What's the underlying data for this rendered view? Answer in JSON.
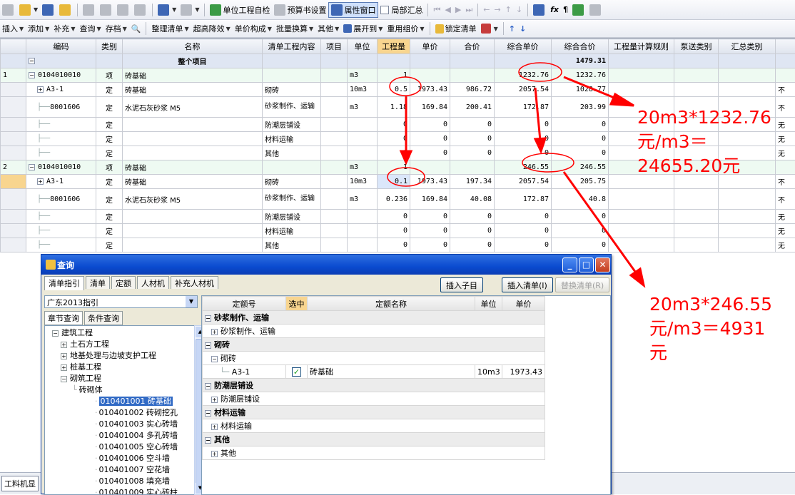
{
  "toolbar1": {
    "self_check": "单位工程自检",
    "budget_settings": "预算书设置",
    "property_window": "属性窗口",
    "partial_summary": "局部汇总"
  },
  "toolbar2": {
    "items": [
      "插入",
      "添加",
      "补充",
      "查询",
      "存档",
      "整理清单",
      "超高降效",
      "单价构成",
      "批量换算",
      "其他",
      "展开到",
      "重用组价",
      "锁定清单"
    ]
  },
  "grid": {
    "headers": [
      "编码",
      "类别",
      "名称",
      "清单工程内容",
      "项目",
      "单位",
      "工程量",
      "单价",
      "合价",
      "综合单价",
      "综合合价",
      "工程量计算规则",
      "泵送类别",
      "汇总类别"
    ],
    "total_row": {
      "name": "整个项目",
      "total": "1479.31"
    },
    "rows": [
      {
        "no": "1",
        "code": "0104010010",
        "cat": "项",
        "name": "砖基础",
        "content": "",
        "unit": "m3",
        "qty": "1",
        "price": "",
        "amount": "",
        "uprice": "1232.76",
        "total": "1232.76",
        "tail": "",
        "kind": "item"
      },
      {
        "no": "",
        "code": "A3-1",
        "cat": "定",
        "name": "砖基础",
        "content": "砌砖",
        "unit": "10m3",
        "qty": "0.5",
        "price": "1973.43",
        "amount": "986.72",
        "uprice": "2057.54",
        "total": "1028.77",
        "tail": "不",
        "kind": "quota"
      },
      {
        "no": "",
        "code": "8001606",
        "cat": "定",
        "name": "水泥石灰砂浆 M5",
        "content": "砂浆制作、运输",
        "unit": "m3",
        "qty": "1.18",
        "price": "169.84",
        "amount": "200.41",
        "uprice": "172.87",
        "total": "203.99",
        "tail": "不",
        "kind": "mat"
      },
      {
        "no": "",
        "code": "",
        "cat": "定",
        "name": "",
        "content": "防潮层铺设",
        "unit": "",
        "qty": "0",
        "price": "0",
        "amount": "0",
        "uprice": "0",
        "total": "0",
        "tail": "无",
        "kind": "empty"
      },
      {
        "no": "",
        "code": "",
        "cat": "定",
        "name": "",
        "content": "材料运输",
        "unit": "",
        "qty": "0",
        "price": "0",
        "amount": "0",
        "uprice": "0",
        "total": "0",
        "tail": "无",
        "kind": "empty"
      },
      {
        "no": "",
        "code": "",
        "cat": "定",
        "name": "",
        "content": "其他",
        "unit": "",
        "qty": "0",
        "price": "0",
        "amount": "0",
        "uprice": "0",
        "total": "0",
        "tail": "无",
        "kind": "empty"
      },
      {
        "no": "2",
        "code": "0104010010",
        "cat": "项",
        "name": "砖基础",
        "content": "",
        "unit": "m3",
        "qty": "1",
        "price": "",
        "amount": "",
        "uprice": "246.55",
        "total": "246.55",
        "tail": "",
        "kind": "item"
      },
      {
        "no": "",
        "code": "A3-1",
        "cat": "定",
        "name": "砖基础",
        "content": "砌砖",
        "unit": "10m3",
        "qty": "0.1",
        "price": "1973.43",
        "amount": "197.34",
        "uprice": "2057.54",
        "total": "205.75",
        "tail": "不",
        "kind": "quota"
      },
      {
        "no": "",
        "code": "8001606",
        "cat": "定",
        "name": "水泥石灰砂浆 M5",
        "content": "砂浆制作、运输",
        "unit": "m3",
        "qty": "0.236",
        "price": "169.84",
        "amount": "40.08",
        "uprice": "172.87",
        "total": "40.8",
        "tail": "不",
        "kind": "mat"
      },
      {
        "no": "",
        "code": "",
        "cat": "定",
        "name": "",
        "content": "防潮层铺设",
        "unit": "",
        "qty": "0",
        "price": "0",
        "amount": "0",
        "uprice": "0",
        "total": "0",
        "tail": "无",
        "kind": "empty"
      },
      {
        "no": "",
        "code": "",
        "cat": "定",
        "name": "",
        "content": "材料运输",
        "unit": "",
        "qty": "0",
        "price": "0",
        "amount": "0",
        "uprice": "0",
        "total": "0",
        "tail": "无",
        "kind": "empty"
      },
      {
        "no": "",
        "code": "",
        "cat": "定",
        "name": "",
        "content": "其他",
        "unit": "",
        "qty": "0",
        "price": "0",
        "amount": "0",
        "uprice": "0",
        "total": "0",
        "tail": "无",
        "kind": "empty"
      }
    ]
  },
  "bottom_tab": "工料机显",
  "dialog": {
    "title": "查询",
    "tabs": [
      "清单指引",
      "清单",
      "定额",
      "人材机",
      "补充人材机"
    ],
    "btn_insert_child": "插入子目",
    "btn_insert_list": "插入清单(I)",
    "btn_replace_list": "替换清单(R)",
    "guide_select": "广东2013指引",
    "left_tabs": [
      "章节查询",
      "条件查询"
    ],
    "tree": [
      {
        "label": "建筑工程",
        "level": 0,
        "pm": "−",
        "sel": false
      },
      {
        "label": "土石方工程",
        "level": 1,
        "pm": "+",
        "sel": false
      },
      {
        "label": "地基处理与边坡支护工程",
        "level": 1,
        "pm": "+",
        "sel": false
      },
      {
        "label": "桩基工程",
        "level": 1,
        "pm": "+",
        "sel": false
      },
      {
        "label": "砌筑工程",
        "level": 1,
        "pm": "−",
        "sel": false
      },
      {
        "label": "砖砌体",
        "level": 2,
        "pm": "",
        "sel": false
      },
      {
        "label": "010401001  砖基础",
        "level": 3,
        "pm": "",
        "sel": true
      },
      {
        "label": "010401002  砖砌挖孔",
        "level": 3,
        "pm": "",
        "sel": false
      },
      {
        "label": "010401003  实心砖墙",
        "level": 3,
        "pm": "",
        "sel": false
      },
      {
        "label": "010401004  多孔砖墙",
        "level": 3,
        "pm": "",
        "sel": false
      },
      {
        "label": "010401005  空心砖墙",
        "level": 3,
        "pm": "",
        "sel": false
      },
      {
        "label": "010401006  空斗墙",
        "level": 3,
        "pm": "",
        "sel": false
      },
      {
        "label": "010401007  空花墙",
        "level": 3,
        "pm": "",
        "sel": false
      },
      {
        "label": "010401008  填充墙",
        "level": 3,
        "pm": "",
        "sel": false
      },
      {
        "label": "010401009  实心砖柱",
        "level": 3,
        "pm": "",
        "sel": false
      }
    ],
    "qheaders": [
      "定额号",
      "选中",
      "定额名称",
      "单位",
      "单价"
    ],
    "qrows": [
      {
        "type": "group",
        "text": "砂浆制作、运输"
      },
      {
        "type": "sub",
        "text": "砂浆制作、运输"
      },
      {
        "type": "group",
        "text": "砌砖"
      },
      {
        "type": "sub2",
        "text": "砌砖"
      },
      {
        "type": "data",
        "code": "A3-1",
        "checked": true,
        "name": "砖基础",
        "unit": "10m3",
        "price": "1973.43"
      },
      {
        "type": "group",
        "text": "防潮层铺设"
      },
      {
        "type": "sub",
        "text": "防潮层铺设"
      },
      {
        "type": "group",
        "text": "材料运输"
      },
      {
        "type": "sub",
        "text": "材料运输"
      },
      {
        "type": "group",
        "text": "其他"
      },
      {
        "type": "sub",
        "text": "其他"
      }
    ]
  },
  "annotations": {
    "note1": [
      "20m3*1232.76",
      "元/m3＝",
      "24655.20元"
    ],
    "note2": [
      "20m3*246.55",
      "元/m3＝4931",
      "元"
    ],
    "color": "#ff0000"
  }
}
